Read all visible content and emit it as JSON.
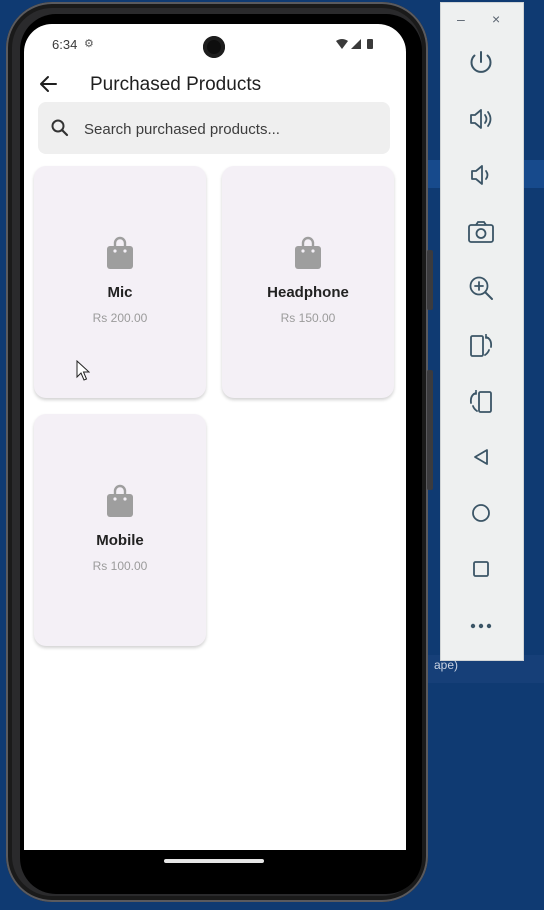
{
  "status_bar": {
    "time": "6:34"
  },
  "app_bar": {
    "title": "Purchased Products"
  },
  "search": {
    "placeholder": "Search purchased products..."
  },
  "products": [
    {
      "name": "Mic",
      "price": "Rs 200.00"
    },
    {
      "name": "Headphone",
      "price": "Rs 150.00"
    },
    {
      "name": "Mobile",
      "price": "Rs 100.00"
    }
  ],
  "emulator_toolbar": {
    "minimize_label": "–",
    "close_label": "×",
    "buttons": [
      "power-icon",
      "volume-up-icon",
      "volume-down-icon",
      "camera-icon",
      "zoom-in-icon",
      "rotate-left-icon",
      "rotate-right-icon",
      "back-triangle-icon",
      "home-circle-icon",
      "overview-square-icon",
      "more-options-icon"
    ]
  },
  "desktop": {
    "partial_text": "ape)"
  },
  "colors": {
    "card_bg": "#f4f0f6",
    "icon_gray": "#9e9e9e",
    "desktop_blue": "#0f3a72"
  }
}
